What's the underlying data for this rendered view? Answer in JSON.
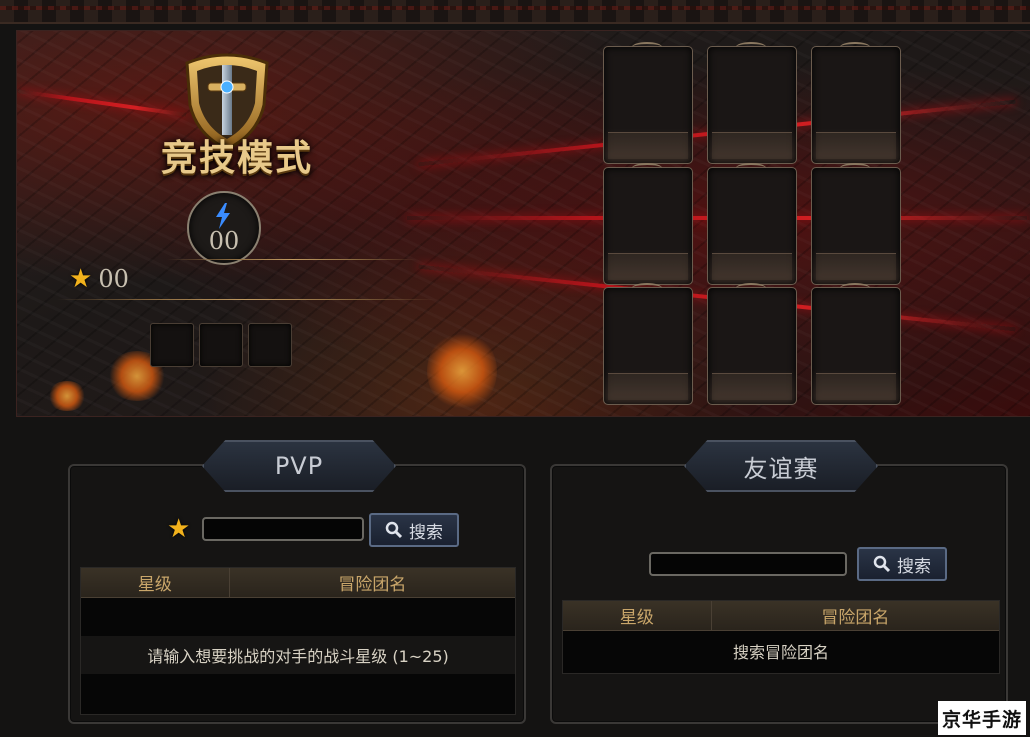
{
  "mode": {
    "title": "竞技模式",
    "energy_value": "00",
    "star_value": "00"
  },
  "pvp": {
    "header": "PVP",
    "search_label": "搜索",
    "search_value": "",
    "columns": [
      "星级",
      "冒险团名"
    ],
    "hint": "请输入想要挑战的对手的战斗星级 (1~25)"
  },
  "friendly": {
    "header": "友谊赛",
    "search_label": "搜索",
    "search_value": "",
    "columns": [
      "星级",
      "冒险团名"
    ],
    "hint": "搜索冒险团名"
  },
  "watermark": "京华手游",
  "icons": [
    "sword-shield-emblem-icon",
    "lightning-icon",
    "star-icon",
    "magnifier-icon"
  ],
  "colors": {
    "accent_gold": "#e8c98a",
    "star": "#f2b21c",
    "red_streak": "#d41f22",
    "header_text": "#c9a66a"
  }
}
